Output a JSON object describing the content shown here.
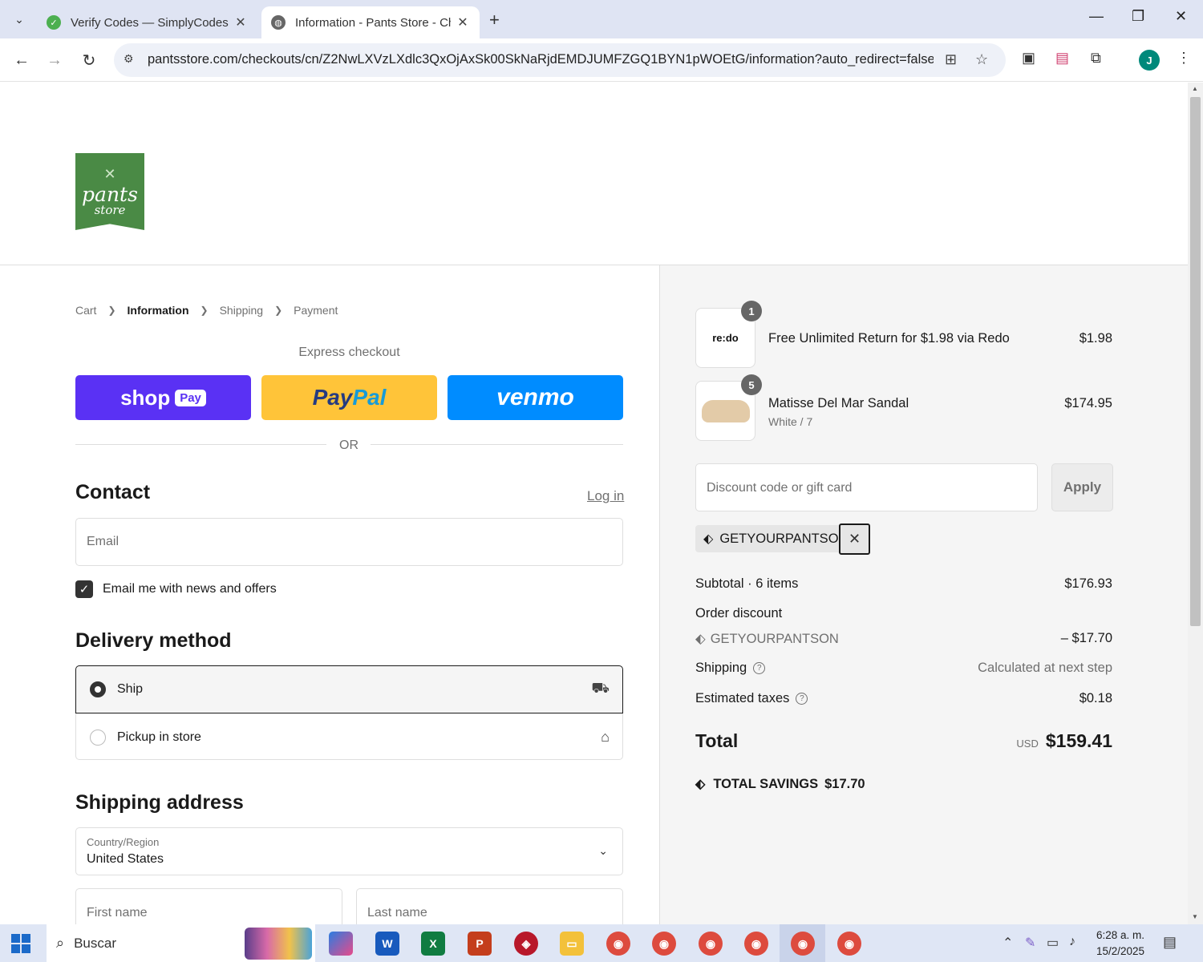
{
  "browser": {
    "tabs": [
      {
        "title": "Verify Codes — SimplyCodes",
        "active": false
      },
      {
        "title": "Information - Pants Store - Che",
        "active": true
      }
    ],
    "url": "pantsstore.com/checkouts/cn/Z2NwLXVzLXdlc3QxOjAxSk00SkNaRjdEMDJUMFZGQ1BYN1pWOEtG/information?auto_redirect=false&...",
    "profile_initial": "J"
  },
  "store": {
    "logo_line1": "pants",
    "logo_line2": "store"
  },
  "breadcrumb": {
    "cart": "Cart",
    "information": "Information",
    "shipping": "Shipping",
    "payment": "Payment"
  },
  "express": {
    "label": "Express checkout",
    "shop_pay": "shop",
    "shop_pay_pill": "Pay",
    "paypal_a": "Pay",
    "paypal_b": "Pal",
    "venmo": "venmo",
    "or": "OR"
  },
  "contact": {
    "heading": "Contact",
    "login": "Log in",
    "email_placeholder": "Email",
    "news_label": "Email me with news and offers",
    "news_checked": true
  },
  "delivery": {
    "heading": "Delivery method",
    "options": [
      {
        "label": "Ship",
        "selected": true,
        "icon": "truck-icon"
      },
      {
        "label": "Pickup in store",
        "selected": false,
        "icon": "store-icon"
      }
    ]
  },
  "shipping_address": {
    "heading": "Shipping address",
    "country_label": "Country/Region",
    "country_value": "United States",
    "first_name_placeholder": "First name",
    "last_name_placeholder": "Last name"
  },
  "summary": {
    "items": [
      {
        "qty": "1",
        "name": "Free Unlimited Return for $1.98 via Redo",
        "variant": "",
        "price": "$1.98",
        "thumb": "re:do"
      },
      {
        "qty": "5",
        "name": "Matisse Del Mar Sandal",
        "variant": "White / 7",
        "price": "$174.95"
      }
    ],
    "discount_placeholder": "Discount code or gift card",
    "apply": "Apply",
    "applied_code": "GETYOURPANTSON",
    "subtotal_label": "Subtotal · 6 items",
    "subtotal_value": "$176.93",
    "order_discount_label": "Order discount",
    "order_discount_code": "GETYOURPANTSON",
    "order_discount_value": "– $17.70",
    "shipping_label": "Shipping",
    "shipping_value": "Calculated at next step",
    "taxes_label": "Estimated taxes",
    "taxes_value": "$0.18",
    "total_label": "Total",
    "total_currency": "USD",
    "total_value": "$159.41",
    "savings_label": "TOTAL SAVINGS",
    "savings_value": "$17.70"
  },
  "taskbar": {
    "search": "Buscar",
    "time": "6:28 a. m.",
    "date": "15/2/2025"
  }
}
